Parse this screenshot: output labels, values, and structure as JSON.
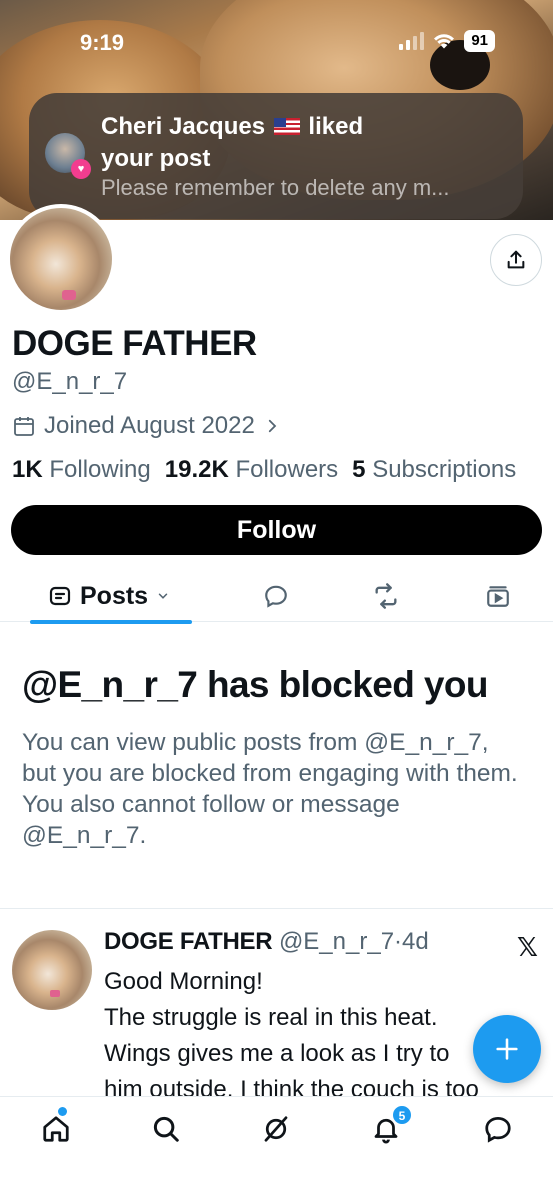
{
  "status_bar": {
    "time": "9:19",
    "battery": "91"
  },
  "notification": {
    "title_name": "Cheri Jacques",
    "title_action_1": "liked",
    "title_action_2": "your post",
    "body": "Please remember to delete any m..."
  },
  "profile": {
    "display_name": "DOGE FATHER",
    "handle": "@E_n_r_7",
    "joined": "Joined August 2022",
    "following_count": "1K",
    "following_label": "Following",
    "followers_count": "19.2K",
    "followers_label": "Followers",
    "subscriptions_count": "5",
    "subscriptions_label": "Subscriptions",
    "follow_button": "Follow"
  },
  "tabs": {
    "posts_label": "Posts"
  },
  "blocked": {
    "title": "@E_n_r_7 has blocked you",
    "text": "You can view public posts from @E_n_r_7, but you are blocked from engaging with them. You also cannot follow or message @E_n_r_7."
  },
  "post": {
    "name": "DOGE FATHER",
    "handle": "@E_n_r_7",
    "separator": "·",
    "age": "4d",
    "lines": [
      "Good Morning!",
      "The struggle is real in this heat.",
      "Wings gives me a look as I try to",
      "him outside. I think the couch is too"
    ]
  },
  "bottom_nav": {
    "notifications_badge": "5"
  },
  "colors": {
    "accent": "#1d9bf0",
    "secondary_text": "#536471",
    "primary_text": "#0f1419"
  }
}
